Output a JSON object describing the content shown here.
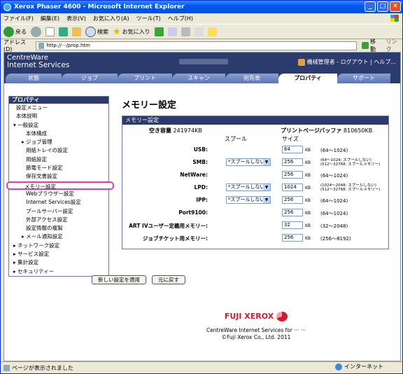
{
  "window": {
    "title": "Xerox Phaser 4600 - Microsoft Internet Explorer"
  },
  "menu": [
    "ファイル(F)",
    "編集(E)",
    "表示(V)",
    "お気に入り(A)",
    "ツール(T)",
    "ヘルプ(H)"
  ],
  "toolbar": {
    "back": "戻る",
    "search": "検索",
    "favorites": "お気に入り"
  },
  "address": {
    "label": "アドレス(D)",
    "url": "http://···/prop.htm",
    "go": "移動",
    "links": "リンク"
  },
  "header": {
    "brand_line1": "CentreWare",
    "brand_line2": "Internet Services",
    "user": "機械管理者 - ログアウト | ヘルプ..."
  },
  "tabs": [
    "状態",
    "ジョブ",
    "プリント",
    "スキャン",
    "宛先表",
    "プロパティ",
    "サポート"
  ],
  "sidebar": {
    "title": "プロパティ",
    "items": [
      "設定メニュー",
      "本体説明",
      "▾ 一般設定",
      "本体構成",
      "▸ ジョブ管理",
      "用紙トレイの設定",
      "用紙設定",
      "節電モード設定",
      "保存文書設定",
      "メモリー設定",
      "Webブラウザー設定",
      "Internet Services設定",
      "プールサーバー設定",
      "外部アクセス設定",
      "設定情報の複製",
      "▸ メール通知設定",
      "▸ ネットワーク設定",
      "▸ サービス設定",
      "▸ 集計設定",
      "▸ セキュリティー"
    ]
  },
  "main": {
    "title": "メモリー設定",
    "panel_title": "メモリー設定",
    "free_label": "空き容量",
    "free_value": "241974KB",
    "buffer_label": "プリントページバッファ",
    "buffer_value": "810650KB",
    "col_spool": "スプール",
    "col_size": "サイズ",
    "unit": "KB",
    "rows": [
      {
        "label": "USB:",
        "select": "",
        "value": "64",
        "range": "(64〜1024)",
        "range2": ""
      },
      {
        "label": "SMB:",
        "select": "*スプールしない",
        "value": "256",
        "range": "(64〜1024: スプールしない)",
        "range2": "(512〜32768: スプールメモリー)"
      },
      {
        "label": "NetWare:",
        "select": "",
        "value": "256",
        "range": "(64〜1024)",
        "range2": ""
      },
      {
        "label": "LPD:",
        "select": "*スプールしない",
        "value": "1024",
        "range": "(1024〜2048: スプールしない)",
        "range2": "(512〜32768: スプールメモリー)"
      },
      {
        "label": "IPP:",
        "select": "*スプールしない",
        "value": "256",
        "range": "(64〜1024)",
        "range2": ""
      },
      {
        "label": "Port9100:",
        "select": "",
        "value": "256",
        "range": "(64〜1024)",
        "range2": ""
      },
      {
        "label": "ART IVユーザー定義用メモリー:",
        "select": "",
        "value": "32",
        "range": "(32〜2048)",
        "range2": ""
      },
      {
        "label": "ジョブチケット用メモリー:",
        "select": "",
        "value": "256",
        "range": "(256〜8192)",
        "range2": ""
      }
    ],
    "apply_button": "新しい設定を適用",
    "reset_button": "元に戻す"
  },
  "footer": {
    "logo": "FUJI XEROX",
    "line1": "CentreWare Internet Services for ··· ···",
    "line2": "©Fuji Xerox Co., Ltd. 2011"
  },
  "status": {
    "text": "ページが表示されました",
    "zone": "インターネット"
  }
}
